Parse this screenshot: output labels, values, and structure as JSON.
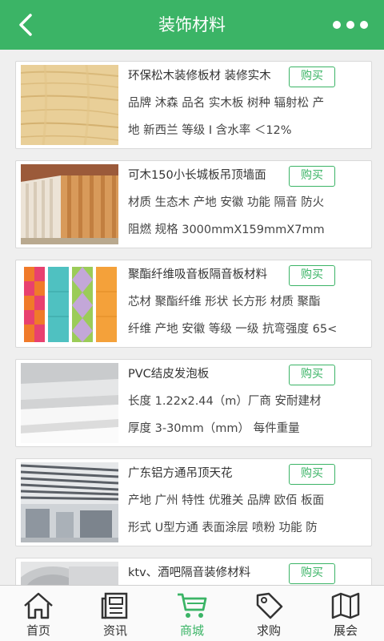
{
  "header": {
    "title": "装饰材料"
  },
  "products": [
    {
      "title": "环保松木装修板材 装修实木",
      "buy_label": "购买",
      "line1": "品牌 沐森 品名 实木板 树种 辐射松 产",
      "line2": "地 新西兰 等级 Ⅰ 含水率 ＜12%",
      "thumb_caption": ""
    },
    {
      "title": "可木150小长城板吊顶墙面",
      "buy_label": "购买",
      "line1": "材质 生态木 产地 安徽 功能 隔音 防火",
      "line2": "阻燃 规格 3000mmX159mmX7mm"
    },
    {
      "title": "聚酯纤维吸音板隔音板材料",
      "buy_label": "购买",
      "line1": "芯材 聚酯纤维 形状 长方形 材质 聚酯",
      "line2": "纤维 产地 安徽 等级 一级 抗弯强度 65<"
    },
    {
      "title": "PVC结皮发泡板",
      "buy_label": "购买",
      "line1": "长度 1.22x2.44（m）厂商 安耐建材",
      "line2": "厚度 3-30mm（mm） 每件重量"
    },
    {
      "title": "广东铝方通吊顶天花",
      "buy_label": "购买",
      "line1": "产地 广州 特性 优雅关 品牌 欧佰 板面",
      "line2": "形式 U型方通 表面涂层 喷粉 功能 防"
    },
    {
      "title": "ktv、酒吧隔音装修材料",
      "buy_label": "购买",
      "line1": "",
      "line2": ""
    }
  ],
  "tabs": [
    {
      "label": "首页",
      "icon": "home-icon"
    },
    {
      "label": "资讯",
      "icon": "news-icon"
    },
    {
      "label": "商城",
      "icon": "cart-icon",
      "active": true
    },
    {
      "label": "求购",
      "icon": "tag-icon"
    },
    {
      "label": "展会",
      "icon": "map-icon"
    }
  ],
  "colors": {
    "accent": "#3bb466"
  }
}
